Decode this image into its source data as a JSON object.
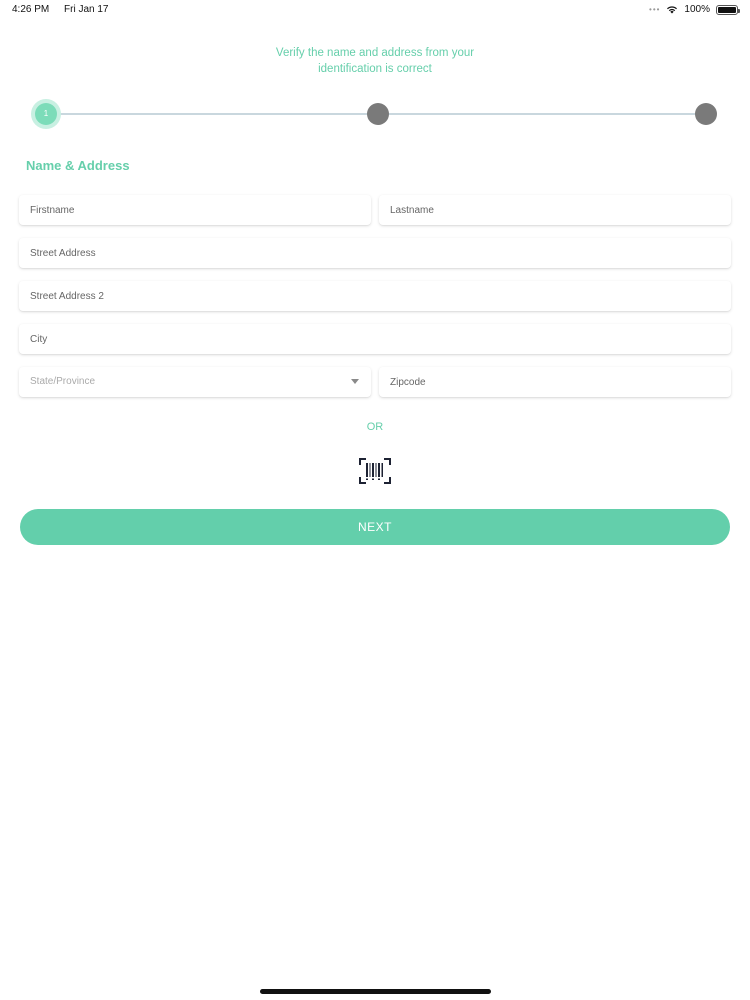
{
  "status_bar": {
    "time": "4:26 PM",
    "date": "Fri Jan 17",
    "battery": "100%"
  },
  "instruction": {
    "line1": "Verify the name and address from your",
    "line2": "identification is correct"
  },
  "stepper": {
    "current_step": 1,
    "total_steps": 3,
    "active_label": "1"
  },
  "section_title": "Name & Address",
  "form": {
    "firstname_placeholder": "Firstname",
    "lastname_placeholder": "Lastname",
    "street_placeholder": "Street Address",
    "street2_placeholder": "Street Address 2",
    "city_placeholder": "City",
    "state_placeholder": "State/Province",
    "zip_placeholder": "Zipcode"
  },
  "or_label": "OR",
  "scan_icon": "barcode-scan-icon",
  "next_label": "NEXT",
  "colors": {
    "accent": "#63cfab",
    "inactive_step": "#7a7a7a",
    "background": "#ffffff"
  }
}
